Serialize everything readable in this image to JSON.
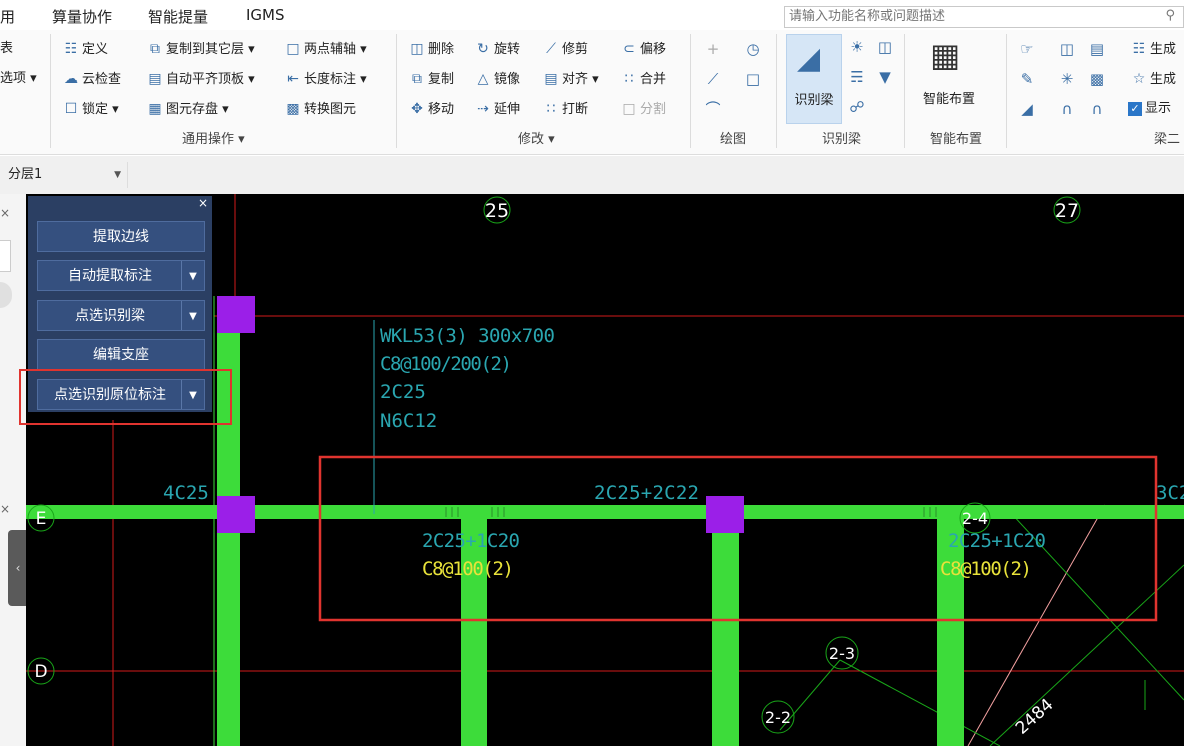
{
  "menu": {
    "items": [
      "用",
      "算量协作",
      "智能提量",
      "IGMS"
    ]
  },
  "search": {
    "placeholder": "请输入功能名称或问题描述"
  },
  "ribbon": {
    "left_cut": [
      "表",
      "选项 ▾"
    ],
    "general": {
      "items": [
        "定义",
        "复制到其它层 ▾",
        "两点辅轴 ▾",
        "云检查",
        "自动平齐顶板 ▾",
        "长度标注 ▾",
        "锁定 ▾",
        "图元存盘 ▾",
        "转换图元"
      ],
      "label": "通用操作 ▾"
    },
    "modify": {
      "items": [
        "删除",
        "旋转",
        "修剪",
        "偏移",
        "复制",
        "镜像",
        "对齐 ▾",
        "合并",
        "移动",
        "延伸",
        "打断",
        "分割"
      ],
      "label": "修改 ▾"
    },
    "draw": {
      "label": "绘图"
    },
    "recognize": {
      "button": "识别梁",
      "label": "识别梁"
    },
    "smart": {
      "button": "智能布置",
      "label": "智能布置"
    },
    "beam2": {
      "items": [
        "生成",
        "生成",
        "显示"
      ],
      "label": "梁二"
    }
  },
  "layer": {
    "selected": "分层1"
  },
  "panel": {
    "buttons": [
      "提取边线",
      "自动提取标注",
      "点选识别梁",
      "编辑支座",
      "点选识别原位标注"
    ]
  },
  "drawing": {
    "axis_labels": [
      "25",
      "27",
      "E",
      "D",
      "2-4",
      "2-3",
      "2-2"
    ],
    "beam_label": [
      "WKL53(3) 300x700",
      "C8@100/200(2)",
      "2C25",
      "N6C12"
    ],
    "annotations": [
      "4C25",
      "2C25+2C22",
      "2C25+1C20",
      "C8@100(2)",
      "2C25+1C20",
      "C8@100(2)",
      "3C2",
      "2484"
    ],
    "colors": {
      "background": "#000000",
      "beam": "#3ddc3a",
      "column": "#9b1fe8",
      "axis": "#d21a1a",
      "cyan_text": "#2aa6b0",
      "yellow_text": "#e8e23a",
      "highlight": "#e0342f"
    }
  }
}
